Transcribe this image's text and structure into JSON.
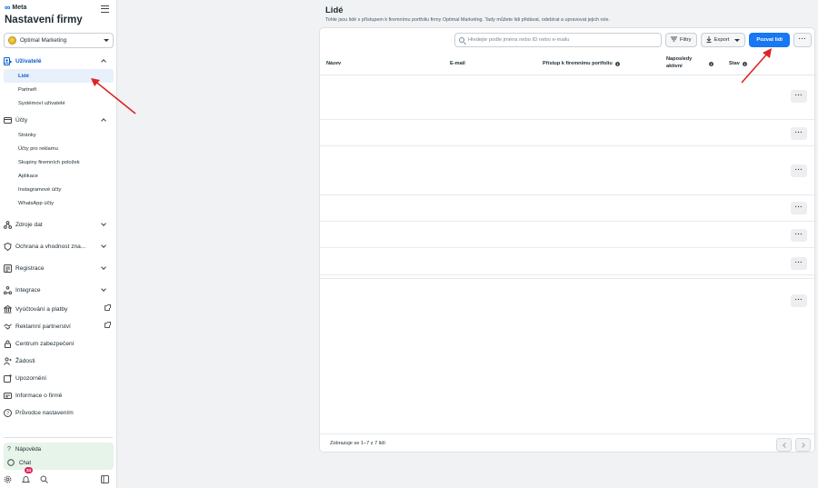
{
  "sidebar": {
    "logo": "Meta",
    "title": "Nastavení firmy",
    "business": "Optimal Marketing",
    "users_group": "Uživatelé",
    "users_items": [
      "Lidé",
      "Partneři",
      "Systémoví uživatelé"
    ],
    "accounts_group": "Účty",
    "accounts_items": [
      "Stránky",
      "Účty pro reklamu",
      "Skupiny firemních položek",
      "Aplikace",
      "Instagramové účty",
      "WhatsApp účty"
    ],
    "groups": [
      "Zdroje dat",
      "Ochrana a vhodnost zna...",
      "Registrace",
      "Integrace"
    ],
    "links": [
      "Vyúčtování a platby",
      "Reklamní partnerství",
      "Centrum zabezpečení",
      "Žádosti",
      "Upozornění",
      "Informace o firmě",
      "Průvodce nastavením"
    ],
    "help": "Nápověda",
    "chat": "Chat",
    "notification_count": "34"
  },
  "main": {
    "title": "Lidé",
    "description": "Tohle jsou lidé s přístupem k firemnímu portfoliu firmy Optimal Marketing. Tady můžete lidi přidávat, odebírat a upravovat jejich role.",
    "search_placeholder": "Hledejte podle jména nebo ID nebo e-mailu",
    "filters_label": "Filtry",
    "export_label": "Export",
    "invite_label": "Pozvat lidi",
    "columns": {
      "name": "Název",
      "email": "E-mail",
      "access": "Přístup k firemnímu portfoliu",
      "last_active": "Naposledy aktivní",
      "status": "Stav"
    },
    "pagination_text": "Zobrazuje se 1–7 z 7 lidí"
  },
  "colors": {
    "accent": "#1877f2",
    "active_nav": "#0a5ecc",
    "annotation_arrow": "#e02424"
  }
}
